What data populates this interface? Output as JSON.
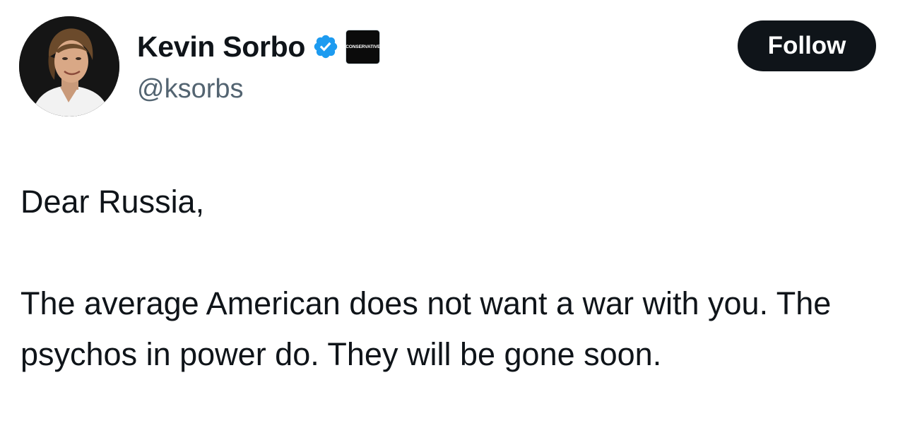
{
  "author": {
    "display_name": "Kevin Sorbo",
    "handle": "@ksorbs",
    "verified": true,
    "verified_icon": "verified-badge-icon",
    "verified_color": "#1d9bf0",
    "affiliate_badge_text": "CONSERVATIVE",
    "avatar": "avatar-photo"
  },
  "actions": {
    "follow_label": "Follow"
  },
  "tweet": {
    "paragraphs": [
      "Dear Russia,",
      "The average American does not want a war with you. The psychos in power do. They will be gone soon."
    ]
  },
  "colors": {
    "text_primary": "#0f1419",
    "text_secondary": "#536471",
    "button_bg": "#0f1419",
    "button_text": "#ffffff"
  }
}
